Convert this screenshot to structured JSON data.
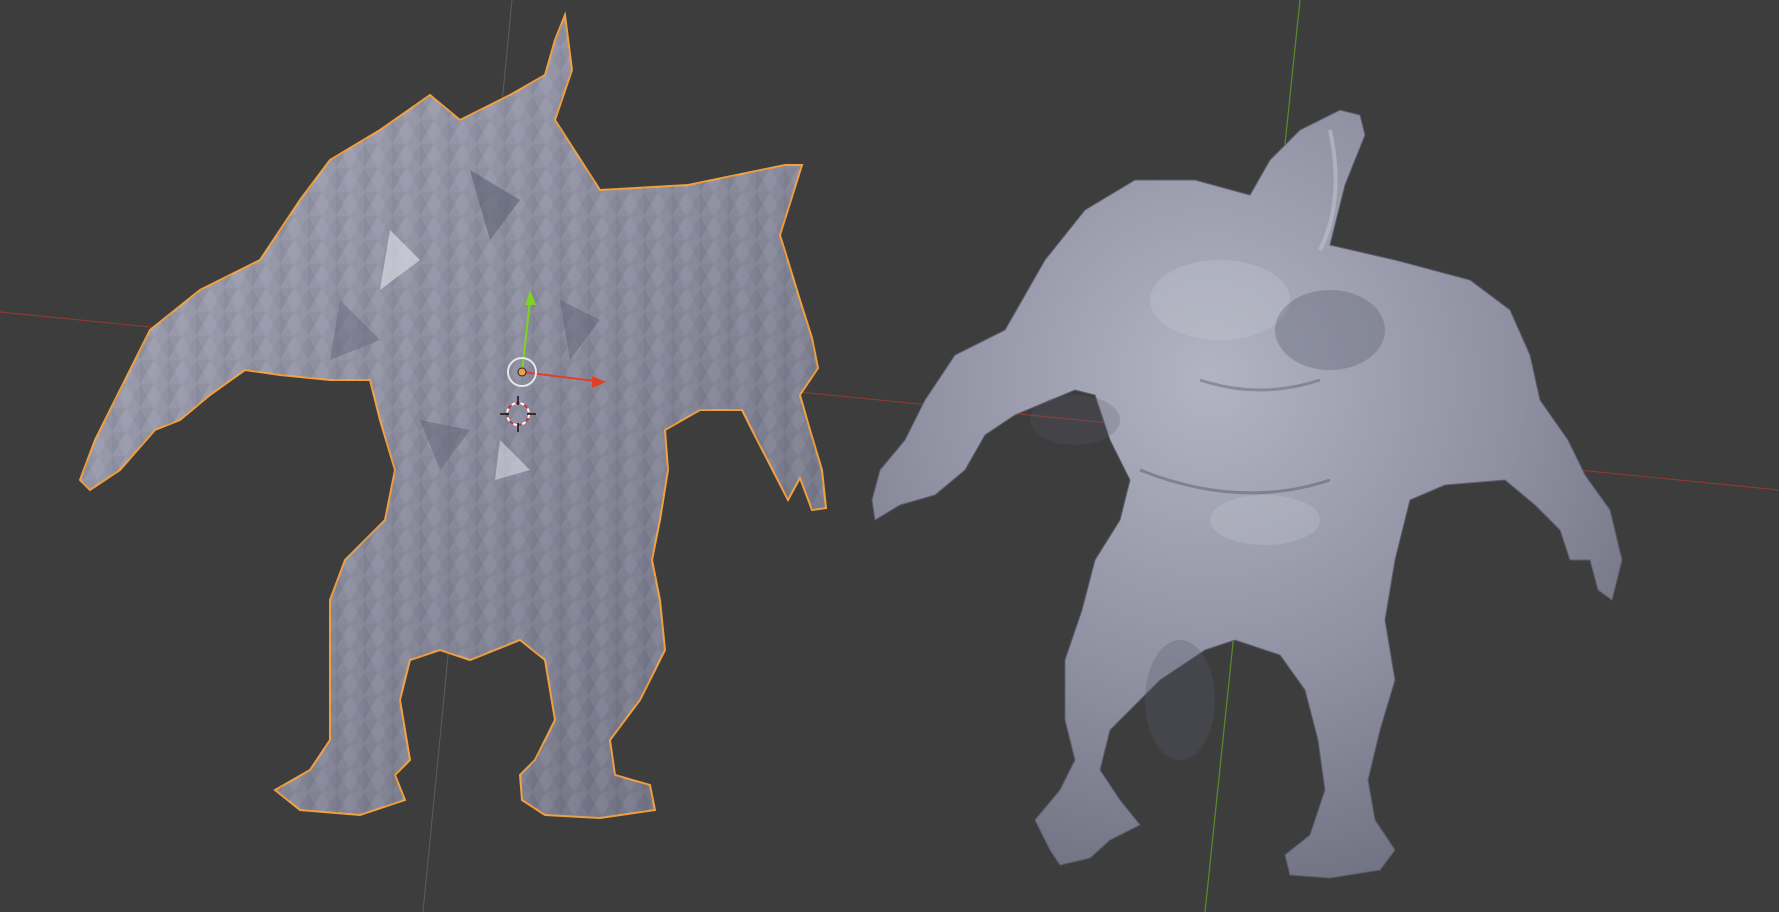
{
  "viewport": {
    "background": "#3d3d3d",
    "axis_x_color": "#8a3a32",
    "axis_y_color": "#5c8a2a",
    "selection_outline_color": "#f0a040"
  },
  "objects": [
    {
      "id": "low-poly-creature",
      "selected": true,
      "shading": "flat"
    },
    {
      "id": "sculpted-creature",
      "selected": false,
      "shading": "smooth"
    }
  ],
  "gizmo": {
    "x_axis_color": "#e0402a",
    "y_axis_color": "#7ed321",
    "origin_color": "#f0a040"
  },
  "cursor": {
    "icon": "3d-cursor-icon"
  }
}
